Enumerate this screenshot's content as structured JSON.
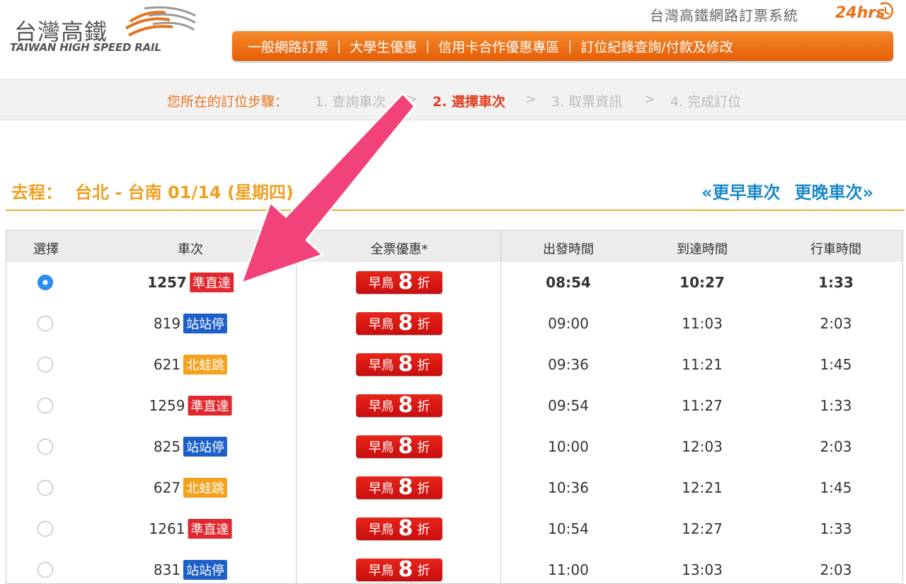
{
  "header": {
    "logo_cn": "台灣高鐵",
    "logo_en": "TAIWAN HIGH SPEED RAIL",
    "system_title": "台灣高鐵網路訂票系統",
    "system_hours": "24hrs"
  },
  "nav": {
    "items": [
      "一般網路訂票",
      "大學生優惠",
      "信用卡合作優惠專區",
      "訂位紀錄查詢/付款及修改"
    ],
    "separator": "|"
  },
  "steps": {
    "label": "您所在的訂位步驟：",
    "items": [
      "1. 查詢車次",
      "2. 選擇車次",
      "3. 取票資訊",
      "4. 完成訂位"
    ],
    "arrow": ">",
    "active_index": 1
  },
  "route": {
    "label": "去程：",
    "text": "台北 - 台南 01/14 (星期四)"
  },
  "pager": {
    "earlier": "«更早車次",
    "later": "更晚車次»"
  },
  "table": {
    "headers": [
      "選擇",
      "車次",
      "全票優惠*",
      "出發時間",
      "到達時間",
      "行車時間"
    ],
    "discount": {
      "label_a": "早鳥",
      "value": "8",
      "label_b": "折"
    },
    "rows": [
      {
        "train": "1257",
        "type": "準直達",
        "type_color": "#e0282e",
        "depart": "08:54",
        "arrive": "10:27",
        "duration": "1:33",
        "selected": true
      },
      {
        "train": "819",
        "type": "站站停",
        "type_color": "#1c5fc8",
        "depart": "09:00",
        "arrive": "11:03",
        "duration": "2:03",
        "selected": false
      },
      {
        "train": "621",
        "type": "北蛙跳",
        "type_color": "#f2a21c",
        "depart": "09:36",
        "arrive": "11:21",
        "duration": "1:45",
        "selected": false
      },
      {
        "train": "1259",
        "type": "準直達",
        "type_color": "#e0282e",
        "depart": "09:54",
        "arrive": "11:27",
        "duration": "1:33",
        "selected": false
      },
      {
        "train": "825",
        "type": "站站停",
        "type_color": "#1c5fc8",
        "depart": "10:00",
        "arrive": "12:03",
        "duration": "2:03",
        "selected": false
      },
      {
        "train": "627",
        "type": "北蛙跳",
        "type_color": "#f2a21c",
        "depart": "10:36",
        "arrive": "12:21",
        "duration": "1:45",
        "selected": false
      },
      {
        "train": "1261",
        "type": "準直達",
        "type_color": "#e0282e",
        "depart": "10:54",
        "arrive": "12:27",
        "duration": "1:33",
        "selected": false
      },
      {
        "train": "831",
        "type": "站站停",
        "type_color": "#1c5fc8",
        "depart": "11:00",
        "arrive": "13:03",
        "duration": "2:03",
        "selected": false
      }
    ]
  },
  "colors": {
    "brand_orange": "#e8731a",
    "route_gold": "#f0a020",
    "pager_blue": "#1b8ac9",
    "step_active": "#e23b1e",
    "annotation_arrow": "#f2427a"
  }
}
